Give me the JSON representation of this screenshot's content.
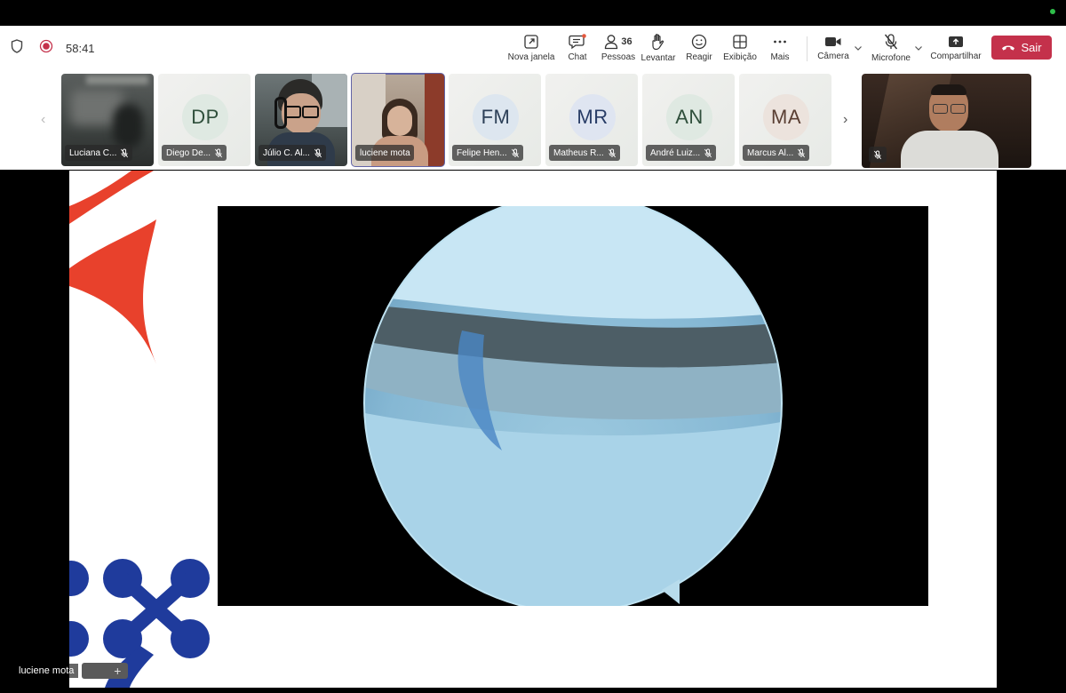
{
  "meeting": {
    "elapsed": "58:41"
  },
  "toolbar": {
    "new_window": "Nova janela",
    "chat": "Chat",
    "people": "Pessoas",
    "people_count": "36",
    "raise_hand": "Levantar",
    "react": "Reagir",
    "view": "Exibição",
    "more": "Mais",
    "camera": "Câmera",
    "microphone": "Microfone",
    "share": "Compartilhar",
    "leave": "Sair",
    "leave_color": "#c4314b"
  },
  "participants": [
    {
      "name": "Luciana C...",
      "type": "video",
      "muted": true
    },
    {
      "name": "Diego De...",
      "initials": "DP",
      "avatar_bg": "#dfe9e2",
      "avatar_fg": "#2f4f3b",
      "muted": true
    },
    {
      "name": "Júlio C. Al...",
      "type": "video",
      "muted": true
    },
    {
      "name": "luciene mota",
      "type": "video",
      "speaking": true,
      "muted": false
    },
    {
      "name": "Felipe Hen...",
      "initials": "FM",
      "avatar_bg": "#dde6ef",
      "avatar_fg": "#2c3f57",
      "muted": true
    },
    {
      "name": "Matheus R...",
      "initials": "MR",
      "avatar_bg": "#dfe5f1",
      "avatar_fg": "#283c66",
      "muted": true
    },
    {
      "name": "André Luiz...",
      "initials": "AN",
      "avatar_bg": "#dfe9e2",
      "avatar_fg": "#2f4f3b",
      "muted": true
    },
    {
      "name": "Marcus Al...",
      "initials": "MA",
      "avatar_bg": "#ece3dd",
      "avatar_fg": "#5a3f33",
      "muted": true
    }
  ],
  "presenter": {
    "name": "luciene mota"
  },
  "colors": {
    "accent": "#6264a7",
    "logo_red": "#e8412c",
    "logo_blue": "#1f3b9c"
  }
}
